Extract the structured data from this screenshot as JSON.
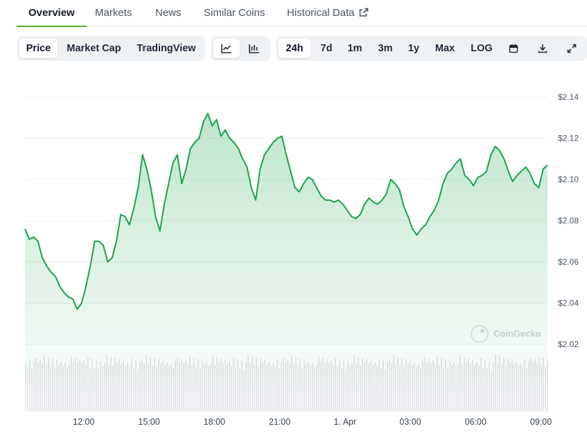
{
  "tabs": [
    {
      "label": "Overview",
      "active": true
    },
    {
      "label": "Markets"
    },
    {
      "label": "News"
    },
    {
      "label": "Similar Coins"
    },
    {
      "label": "Historical Data",
      "icon": "external-link-icon"
    }
  ],
  "toolbar": {
    "view_options": [
      "Price",
      "Market Cap",
      "TradingView"
    ],
    "selected_view": "Price",
    "chart_type_icons": [
      "line-chart-icon",
      "candlestick-chart-icon"
    ],
    "selected_chart_type": "line-chart-icon",
    "ranges": [
      "24h",
      "7d",
      "1m",
      "3m",
      "1y",
      "Max",
      "LOG"
    ],
    "selected_range": "24h",
    "action_icons": [
      "calendar-icon",
      "download-icon",
      "fullscreen-icon"
    ]
  },
  "watermark": "CoinGecko",
  "colors": {
    "line": "#16a34a",
    "accent_tab": "#4caf2a",
    "volume": "#e5e7eb"
  },
  "chart_data": {
    "type": "line",
    "x_tick_labels": [
      "12:00",
      "15:00",
      "18:00",
      "21:00",
      "1. Apr",
      "03:00",
      "06:00",
      "09:00"
    ],
    "x_tick_hours": [
      2.7,
      5.7,
      8.7,
      11.7,
      14.7,
      17.7,
      20.7,
      23.7
    ],
    "y_ticks": [
      2.02,
      2.04,
      2.06,
      2.08,
      2.1,
      2.12,
      2.14
    ],
    "y_tick_labels": [
      "$2.02",
      "$2.04",
      "$2.06",
      "$2.08",
      "$2.10",
      "$2.12",
      "$2.14"
    ],
    "ylim": [
      2.0,
      2.15
    ],
    "grid": true,
    "x_hours_from_start": [
      0,
      0.2,
      0.4,
      0.6,
      0.8,
      1.0,
      1.2,
      1.4,
      1.6,
      1.8,
      2.0,
      2.2,
      2.4,
      2.6,
      2.8,
      3.0,
      3.2,
      3.4,
      3.6,
      3.8,
      4.0,
      4.2,
      4.4,
      4.6,
      4.8,
      5.0,
      5.2,
      5.4,
      5.6,
      5.8,
      6.0,
      6.2,
      6.4,
      6.6,
      6.8,
      7.0,
      7.2,
      7.4,
      7.6,
      7.8,
      8.0,
      8.2,
      8.4,
      8.6,
      8.8,
      9.0,
      9.2,
      9.4,
      9.6,
      9.8,
      10.0,
      10.2,
      10.4,
      10.6,
      10.8,
      11.0,
      11.2,
      11.4,
      11.6,
      11.8,
      12.0,
      12.2,
      12.4,
      12.6,
      12.8,
      13.0,
      13.2,
      13.4,
      13.6,
      13.8,
      14.0,
      14.2,
      14.4,
      14.6,
      14.8,
      15.0,
      15.2,
      15.4,
      15.6,
      15.8,
      16.0,
      16.2,
      16.4,
      16.6,
      16.8,
      17.0,
      17.2,
      17.4,
      17.6,
      17.8,
      18.0,
      18.2,
      18.4,
      18.6,
      18.8,
      19.0,
      19.2,
      19.4,
      19.6,
      19.8,
      20.0,
      20.2,
      20.4,
      20.6,
      20.8,
      21.0,
      21.2,
      21.4,
      21.6,
      21.8,
      22.0,
      22.2,
      22.4,
      22.6,
      22.8,
      23.0,
      23.2,
      23.4,
      23.6,
      23.8
    ],
    "price": [
      2.076,
      2.071,
      2.072,
      2.07,
      2.062,
      2.058,
      2.055,
      2.053,
      2.048,
      2.045,
      2.043,
      2.042,
      2.037,
      2.04,
      2.048,
      2.058,
      2.07,
      2.07,
      2.068,
      2.06,
      2.062,
      2.07,
      2.083,
      2.082,
      2.078,
      2.086,
      2.096,
      2.112,
      2.105,
      2.095,
      2.082,
      2.075,
      2.088,
      2.098,
      2.108,
      2.112,
      2.098,
      2.105,
      2.115,
      2.118,
      2.12,
      2.128,
      2.132,
      2.126,
      2.129,
      2.121,
      2.124,
      2.12,
      2.118,
      2.115,
      2.11,
      2.106,
      2.096,
      2.09,
      2.105,
      2.112,
      2.115,
      2.118,
      2.12,
      2.121,
      2.112,
      2.104,
      2.096,
      2.094,
      2.098,
      2.101,
      2.1,
      2.096,
      2.092,
      2.09,
      2.09,
      2.089,
      2.09,
      2.088,
      2.085,
      2.082,
      2.081,
      2.083,
      2.088,
      2.091,
      2.089,
      2.088,
      2.09,
      2.093,
      2.1,
      2.098,
      2.095,
      2.087,
      2.082,
      2.076,
      2.073,
      2.076,
      2.078,
      2.082,
      2.085,
      2.09,
      2.098,
      2.103,
      2.105,
      2.108,
      2.11,
      2.102,
      2.1,
      2.097,
      2.101,
      2.102,
      2.104,
      2.112,
      2.116,
      2.114,
      2.11,
      2.104,
      2.099,
      2.102,
      2.104,
      2.106,
      2.103,
      2.098,
      2.096,
      2.105
    ]
  }
}
